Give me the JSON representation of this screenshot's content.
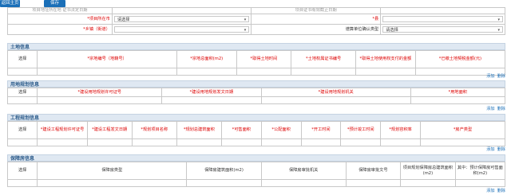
{
  "toolbar": {
    "back_label": "返回主页",
    "save_label": "保存"
  },
  "top_form": {
    "row0_left": "项目地址所在地 证书法定日期",
    "row0_right": "项目证书有效截止日期",
    "row1": {
      "label_left": "*项目所在市",
      "select_left": "请选择",
      "label_right": "*县",
      "select_right": ""
    },
    "row2": {
      "label_left": "*乡镇（街道）",
      "select_left": "",
      "label_right": "谱算单位确认类型",
      "select_right": "请选择"
    }
  },
  "land": {
    "title": "土地信息",
    "headers": [
      "选择",
      "*宗地编号（地籍号）",
      "*宗地总面积(m2)",
      "*取得土地时间",
      "*土地权属证书编号",
      "*取得土地使用权支付的金额",
      "*已缴土地契税金额(元)"
    ]
  },
  "planning": {
    "title": "用地规划信息",
    "headers": [
      "选择",
      "*建设用地规划许可证号",
      "*建设用地规划发文日期",
      "*建设用地规划机关",
      "*用地面积"
    ]
  },
  "engineering": {
    "title": "工程规划信息",
    "headers": [
      "选择",
      "*建设工程规划许可证号",
      "*建设工程发文日期",
      "*规划项目名称",
      "*规划总建筑面积",
      "*可售面积",
      "*公配面积",
      "*开工时间",
      "*预计竣工时间",
      "*规划容积率",
      "*房产类型"
    ]
  },
  "housing": {
    "title": "保障房信息",
    "headers": [
      "选择",
      "保障房类型",
      "保障房建筑面积(m2)",
      "保障房审批机关",
      "保障房审批文号",
      "项目规划保障房总建筑面积(m2)",
      "其中：预计保障房可售面积(m2)"
    ]
  },
  "links": {
    "add": "添加",
    "delete": "删除"
  }
}
